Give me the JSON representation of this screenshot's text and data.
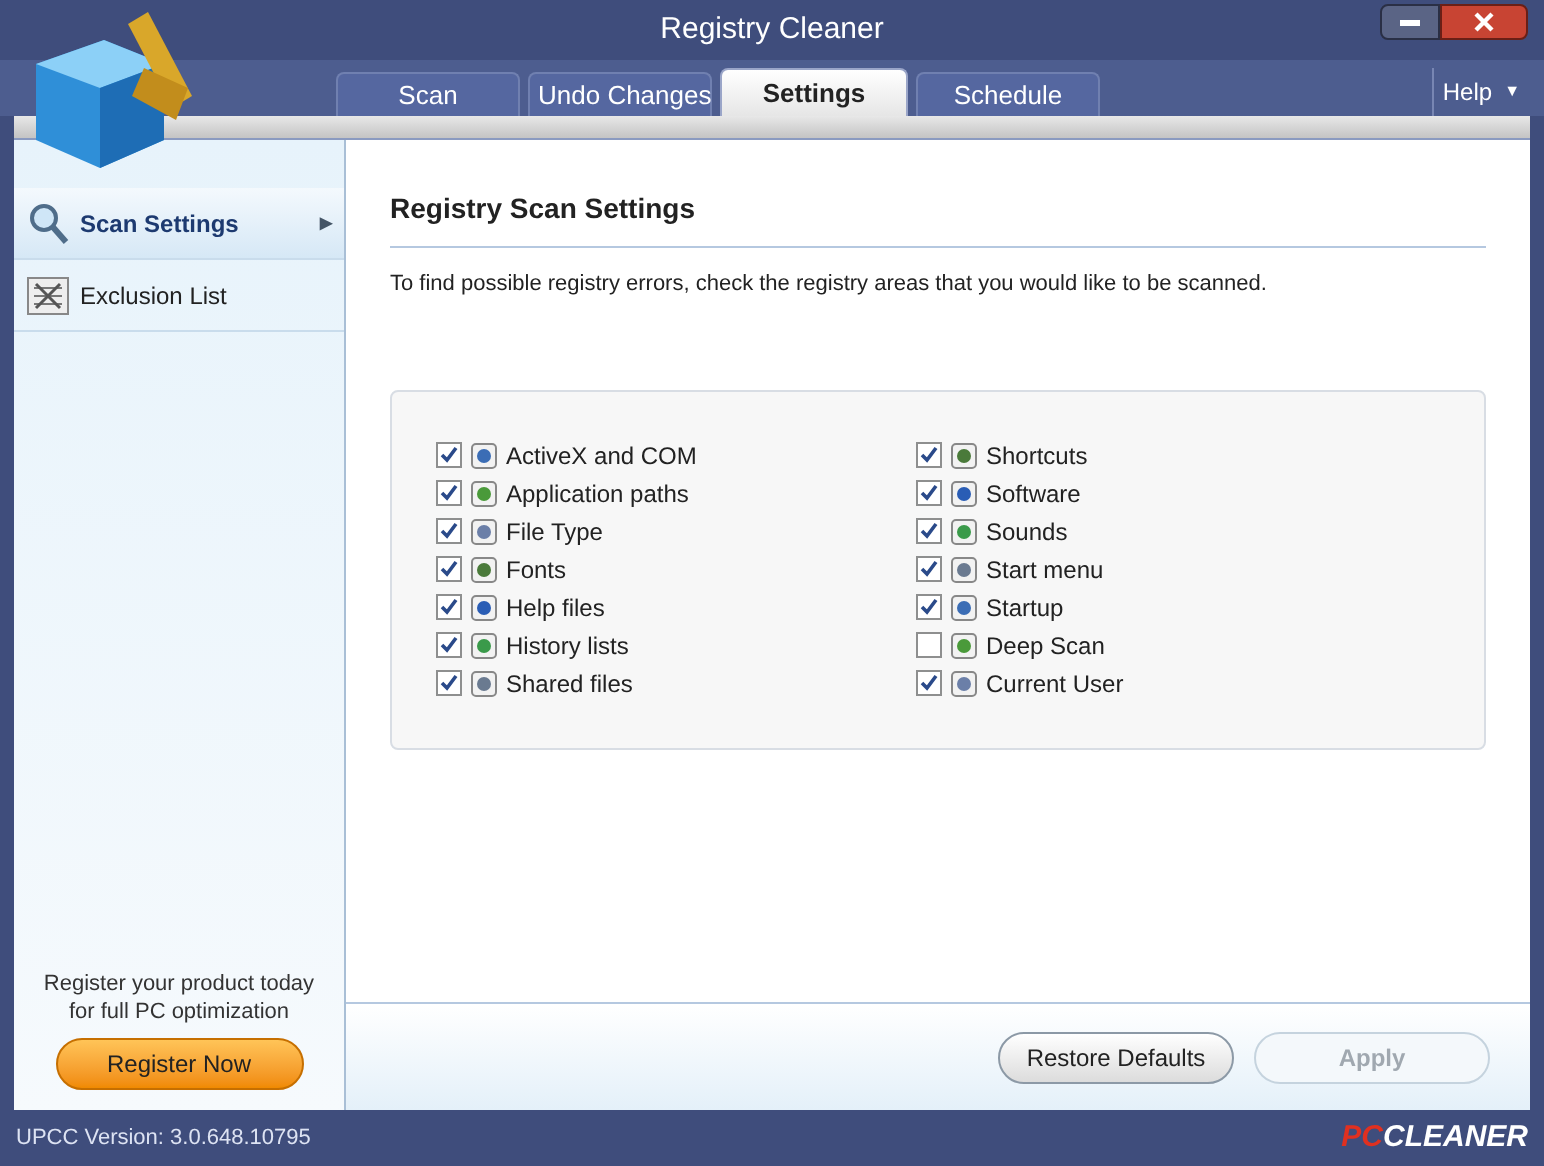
{
  "window": {
    "title": "Registry Cleaner"
  },
  "tabs": [
    {
      "label": "Scan",
      "selected": false
    },
    {
      "label": "Undo Changes",
      "selected": false
    },
    {
      "label": "Settings",
      "selected": true
    },
    {
      "label": "Schedule",
      "selected": false
    }
  ],
  "help_menu": {
    "label": "Help",
    "arrow": "▼"
  },
  "sidebar": {
    "items": [
      {
        "label": "Scan Settings",
        "selected": true,
        "arrow": "▶"
      },
      {
        "label": "Exclusion List",
        "selected": false
      }
    ],
    "promo": "Register your product today for full PC optimization",
    "register_button": "Register Now"
  },
  "panel": {
    "title": "Registry Scan Settings",
    "description": "To find possible registry errors, check the registry areas that you would like to be scanned.",
    "columns": [
      [
        {
          "label": "ActiveX and COM",
          "checked": true
        },
        {
          "label": "Application paths",
          "checked": true
        },
        {
          "label": "File Type",
          "checked": true
        },
        {
          "label": "Fonts",
          "checked": true
        },
        {
          "label": "Help files",
          "checked": true
        },
        {
          "label": "History lists",
          "checked": true
        },
        {
          "label": "Shared files",
          "checked": true
        }
      ],
      [
        {
          "label": "Shortcuts",
          "checked": true
        },
        {
          "label": "Software",
          "checked": true
        },
        {
          "label": "Sounds",
          "checked": true
        },
        {
          "label": "Start menu",
          "checked": true
        },
        {
          "label": "Startup",
          "checked": true
        },
        {
          "label": "Deep Scan",
          "checked": false
        },
        {
          "label": "Current User",
          "checked": true
        }
      ]
    ]
  },
  "buttons": [
    {
      "label": "Restore Defaults",
      "disabled": false
    },
    {
      "label": "Apply",
      "disabled": true
    }
  ],
  "status_bar": {
    "version": "UPCC Version: 3.0.648.10795",
    "brand": [
      "PC",
      "CLEANER"
    ]
  }
}
